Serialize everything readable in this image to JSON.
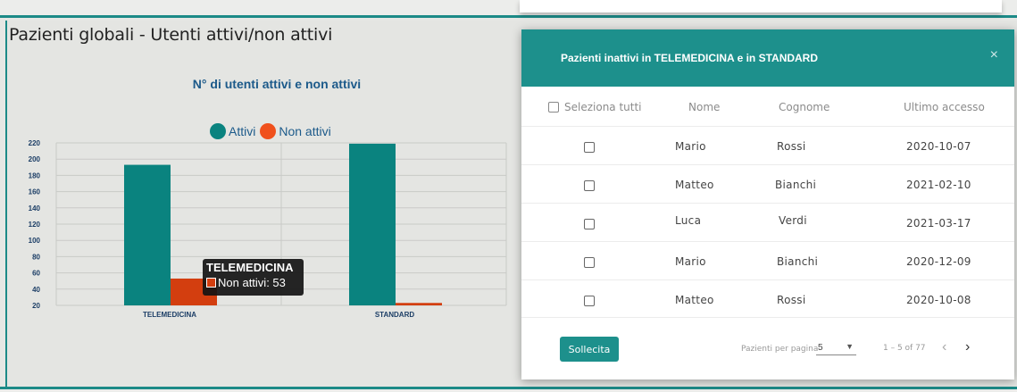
{
  "panel": {
    "title": "Pazienti globali - Utenti attivi/non attivi"
  },
  "chart_data": {
    "type": "bar",
    "title": "N° di utenti attivi e non attivi",
    "categories": [
      "TELEMEDICINA",
      "STANDARD"
    ],
    "series": [
      {
        "name": "Attivi",
        "values": [
          193,
          219
        ],
        "color": "#0a837f"
      },
      {
        "name": "Non attivi",
        "values": [
          53,
          23
        ],
        "color": "#d33e0f"
      }
    ],
    "y_ticks": [
      20,
      40,
      60,
      80,
      100,
      120,
      140,
      160,
      180,
      200,
      220
    ],
    "ylim": [
      20,
      220
    ],
    "legend_placement": "top-center",
    "grid": true,
    "tooltip": {
      "title": "TELEMEDICINA",
      "label": "Non attivi: 53"
    }
  },
  "dialog": {
    "title": "Pazienti inattivi in TELEMEDICINA e in STANDARD",
    "close_icon": "×",
    "columns": {
      "select_all": "Seleziona tutti",
      "name": "Nome",
      "surname": "Cognome",
      "last_access": "Ultimo accesso"
    },
    "rows": [
      {
        "name": "Mario",
        "surname": "Rossi",
        "last_access": "2020-10-07"
      },
      {
        "name": "Matteo",
        "surname": "Bianchi",
        "last_access": "2021-02-10"
      },
      {
        "name": "Luca",
        "surname": "Verdi",
        "last_access": "2021-03-17"
      },
      {
        "name": "Mario",
        "surname": "Bianchi",
        "last_access": "2020-12-09"
      },
      {
        "name": "Matteo",
        "surname": "Rossi",
        "last_access": "2020-10-08"
      }
    ],
    "footer": {
      "button_label": "Sollecita",
      "per_page_label": "Pazienti per pagina",
      "per_page_value": "5",
      "range_label": "1 – 5 of 77",
      "prev_icon": "‹",
      "next_icon": "›"
    }
  },
  "colors": {
    "accent": "#1d908c",
    "active": "#0a837f",
    "inactive": "#d33e0f"
  }
}
